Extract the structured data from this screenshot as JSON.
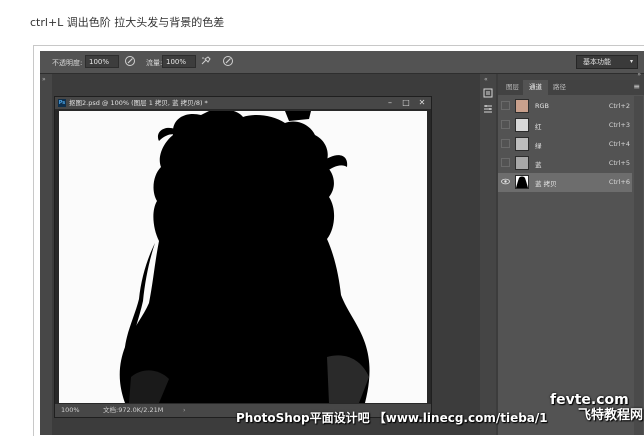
{
  "article": {
    "caption": "ctrl+L 调出色阶 拉大头发与背景的色差"
  },
  "options_bar": {
    "opacity_label": "不透明度:",
    "opacity_value": "100%",
    "flow_label": "流量:",
    "flow_value": "100%",
    "workspace": "基本功能"
  },
  "document": {
    "title": "抠图2.psd @ 100% (图层 1 拷贝, 蓝 拷贝/8) *",
    "badge": "Ps",
    "zoom": "100%",
    "doc_size": "文档:972.0K/2.21M"
  },
  "panel": {
    "tabs": [
      {
        "label": "图层"
      },
      {
        "label": "通道"
      },
      {
        "label": "路径"
      }
    ],
    "channels": [
      {
        "name": "RGB",
        "shortcut": "Ctrl+2"
      },
      {
        "name": "红",
        "shortcut": "Ctrl+3"
      },
      {
        "name": "绿",
        "shortcut": "Ctrl+4"
      },
      {
        "name": "蓝",
        "shortcut": "Ctrl+5"
      },
      {
        "name": "蓝 拷贝",
        "shortcut": "Ctrl+6"
      }
    ]
  },
  "watermark": {
    "text": "PhotoShop平面设计吧 【www.linecg.com/tieba/1",
    "logo_top": "fevte.com",
    "logo_bottom": "飞特教程网"
  },
  "colors": {
    "ui_dark": "#535353",
    "canvas": "#ffffff",
    "silhouette": "#000000"
  }
}
